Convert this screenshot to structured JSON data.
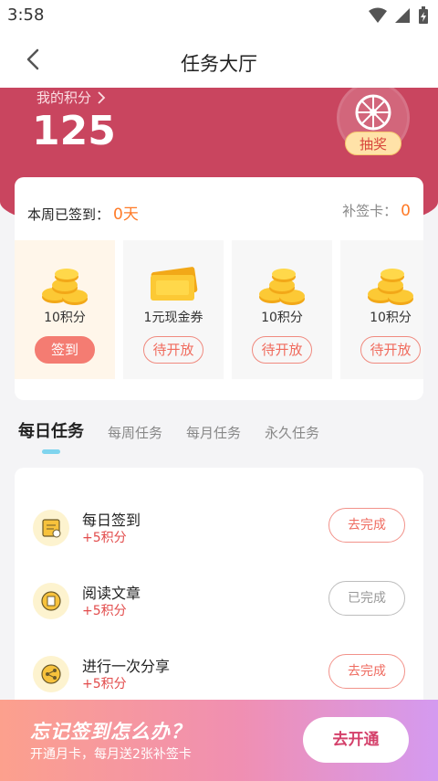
{
  "status_bar": {
    "time": "3:58"
  },
  "nav": {
    "title": "任务大厅"
  },
  "points": {
    "label": "我的积分",
    "value": "125",
    "lottery_label": "抽奖"
  },
  "checkin": {
    "week_label": "本周已签到：",
    "week_days": "0天",
    "makeup_label": "补签卡：",
    "makeup_count": "0",
    "days": [
      {
        "label": "10积分",
        "button": "签到",
        "icon": "coins-icon"
      },
      {
        "label": "1元现金券",
        "button": "待开放",
        "icon": "cash-voucher-icon"
      },
      {
        "label": "10积分",
        "button": "待开放",
        "icon": "coins-icon"
      },
      {
        "label": "10积分",
        "button": "待开放",
        "icon": "coins-icon"
      }
    ]
  },
  "tabs": [
    "每日任务",
    "每周任务",
    "每月任务",
    "永久任务"
  ],
  "tasks": [
    {
      "title": "每日签到",
      "points": "+5积分",
      "button": "去完成",
      "icon": "calendar-icon"
    },
    {
      "title": "阅读文章",
      "points": "+5积分",
      "button": "已完成",
      "icon": "article-icon"
    },
    {
      "title": "进行一次分享",
      "points": "+5积分",
      "button": "去完成",
      "icon": "share-icon"
    }
  ],
  "promo": {
    "title": "忘记签到怎么办？",
    "subtitle": "开通月卡，每月送2张补签卡",
    "button": "去开通"
  },
  "colors": {
    "header": "#c9455f",
    "accent": "#ff7a26",
    "primary_button": "#f47c72"
  }
}
